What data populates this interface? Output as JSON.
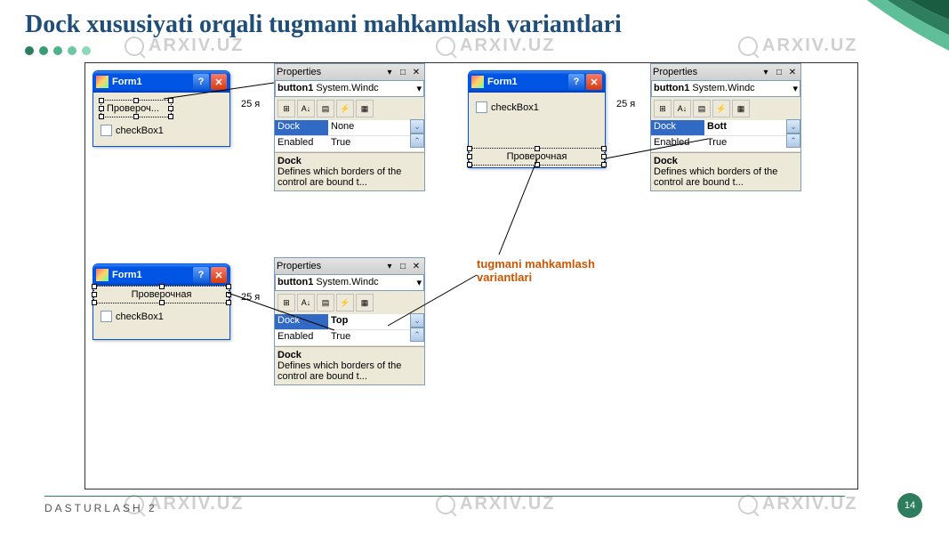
{
  "slide": {
    "title": "Dock xususiyati orqali tugmani mahkamlash variantlari",
    "footer": "DASTURLASH 2",
    "page": "14"
  },
  "watermark": "ARXIV.UZ",
  "annotation": {
    "line1": "tugmani mahkamlash",
    "line2": "variantlari"
  },
  "form": {
    "title": "Form1",
    "help": "?",
    "close": "✕",
    "button_label_short": "Провероч...",
    "button_label_full": "Проверочная",
    "checkbox_label": "checkBox1",
    "date_text": "25  я"
  },
  "properties": {
    "panel_title": "Properties",
    "combo_label": "button1",
    "combo_type": "System.Windc",
    "dock": "Dock",
    "enabled": "Enabled",
    "enabled_val": "True",
    "dock_val_none": "None",
    "dock_val_bott": "Bott",
    "dock_val_top": "Top",
    "desc_title": "Dock",
    "desc_text": "Defines which borders of the control are bound t..."
  }
}
